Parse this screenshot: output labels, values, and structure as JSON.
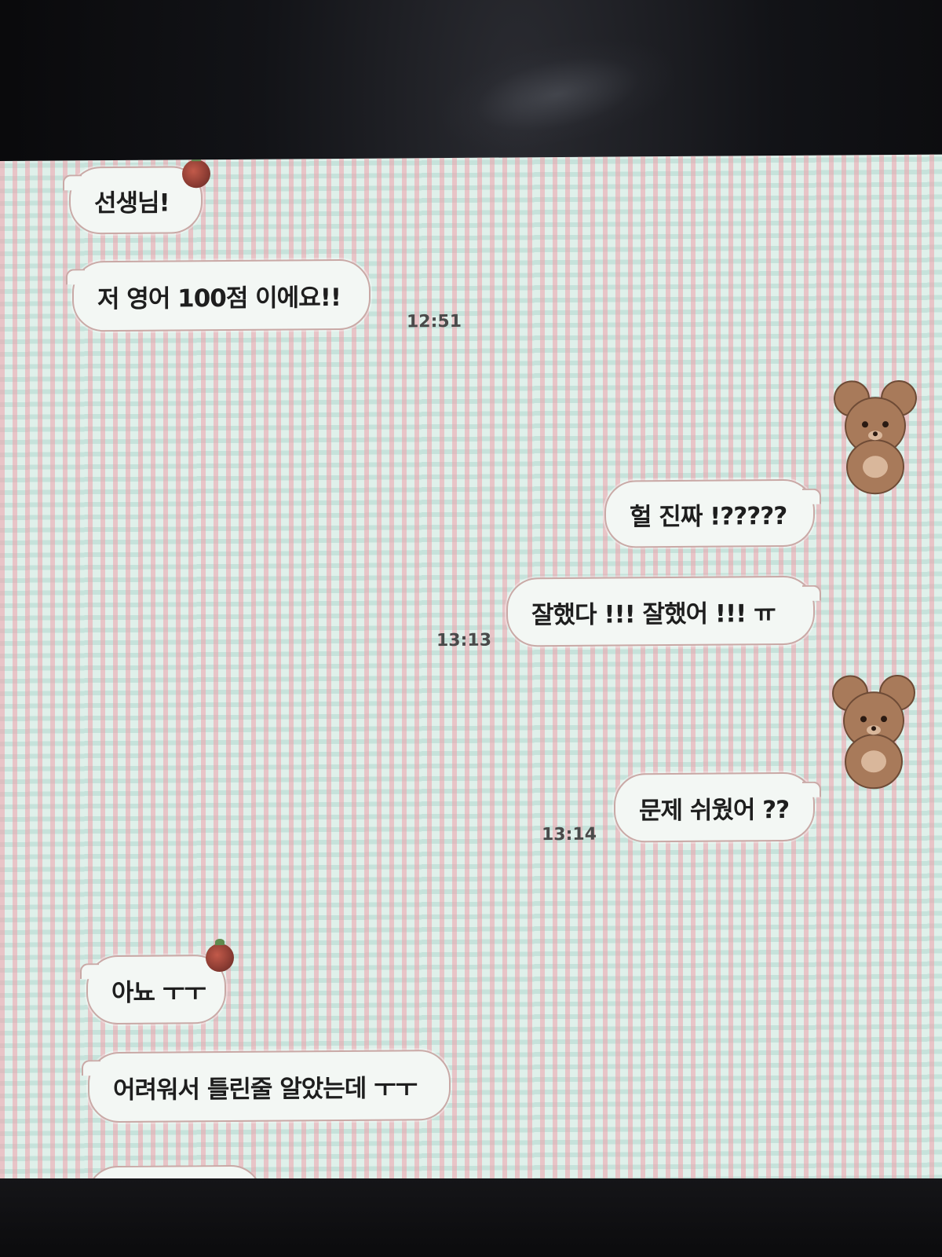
{
  "chat": {
    "messages": [
      {
        "sender": "other",
        "text": "선생님!"
      },
      {
        "sender": "other",
        "text": "저 영어 100점 이에요!!",
        "time": "12:51"
      },
      {
        "sender": "me",
        "text": "헐 진짜 !?????"
      },
      {
        "sender": "me",
        "text": "잘했다 !!! 잘했어 !!!  ㅠ",
        "time": "13:13"
      },
      {
        "sender": "me",
        "text": "문제 쉬웠어 ??",
        "time": "13:14"
      },
      {
        "sender": "other",
        "text": "아뇨 ㅜㅜ"
      },
      {
        "sender": "other",
        "text": "어려워서 틀린줄 알았는데 ㅜㅜ"
      }
    ]
  },
  "colors": {
    "bubble_bg": "#f3f7f4",
    "bubble_border": "#c9a9a6",
    "screen_check_pink": "#f0a0aa",
    "screen_check_mint": "#dff0ea",
    "berry": "#8a3b32",
    "bear": "#a87a5a"
  },
  "icons": {
    "profile_other": "berry-sticker-icon",
    "profile_me": "bear-sticker-icon"
  }
}
